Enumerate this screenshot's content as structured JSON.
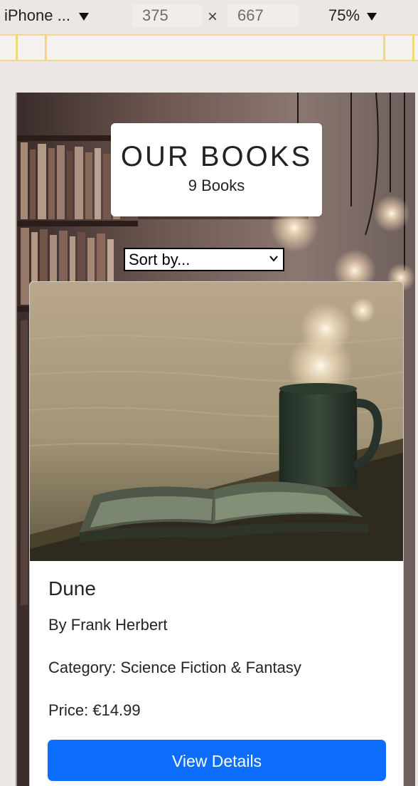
{
  "devtools": {
    "device_name": "iPhone ...",
    "width": "375",
    "times_symbol": "×",
    "height": "667",
    "zoom": "75%"
  },
  "page": {
    "heading": "OUR BOOKS",
    "book_count": "9 Books",
    "sort": {
      "selected": "Sort by..."
    }
  },
  "book": {
    "title": "Dune",
    "author": "By Frank Herbert",
    "category": "Category: Science Fiction & Fantasy",
    "price": "Price: €14.99",
    "button_label": "View Details"
  },
  "colors": {
    "primary_button": "#0d6efd",
    "media_query_bar": "#f1d98a"
  }
}
